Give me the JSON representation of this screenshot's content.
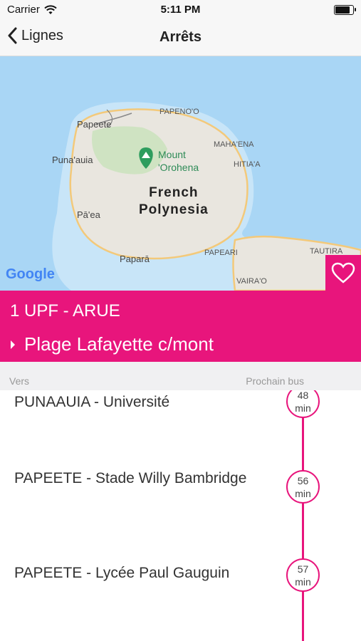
{
  "status": {
    "carrier": "Carrier",
    "time": "5:11 PM",
    "battery_level": 0.85
  },
  "nav": {
    "back_label": "Lignes",
    "title": "Arrêts"
  },
  "map": {
    "labels": {
      "papenoo": "PAPENO'O",
      "papeete": "Papeete",
      "punaauia": "Puna'auia",
      "mahaena": "MAHA'ENA",
      "hitiaa": "HITIA'A",
      "paea": "Pā'ea",
      "papara": "Paparā",
      "papeari": "PAPEARI",
      "tautira": "TAUTIRA",
      "vairao": "VAIRA'O"
    },
    "mount": "Mount\n'Orohena",
    "region": "French\nPolynesia",
    "google": "Google"
  },
  "route": {
    "line": "1 UPF - ARUE",
    "stop": "Plage Lafayette c/mont"
  },
  "table": {
    "header_left": "Vers",
    "header_right": "Prochain bus"
  },
  "departures": [
    {
      "destination": "PUNAAUIA - Université",
      "minutes": "48",
      "unit": "min"
    },
    {
      "destination": "PAPEETE - Stade Willy Bambridge",
      "minutes": "56",
      "unit": "min"
    },
    {
      "destination": "PAPEETE - Lycée Paul Gauguin",
      "minutes": "57",
      "unit": "min"
    }
  ],
  "colors": {
    "accent": "#e8157c",
    "water": "#a9d6f5",
    "land": "#e9e6df"
  },
  "icons": [
    "wifi-icon",
    "battery-icon",
    "chevron-left-icon",
    "heart-icon",
    "caret-right-icon",
    "mountain-pin-icon"
  ]
}
